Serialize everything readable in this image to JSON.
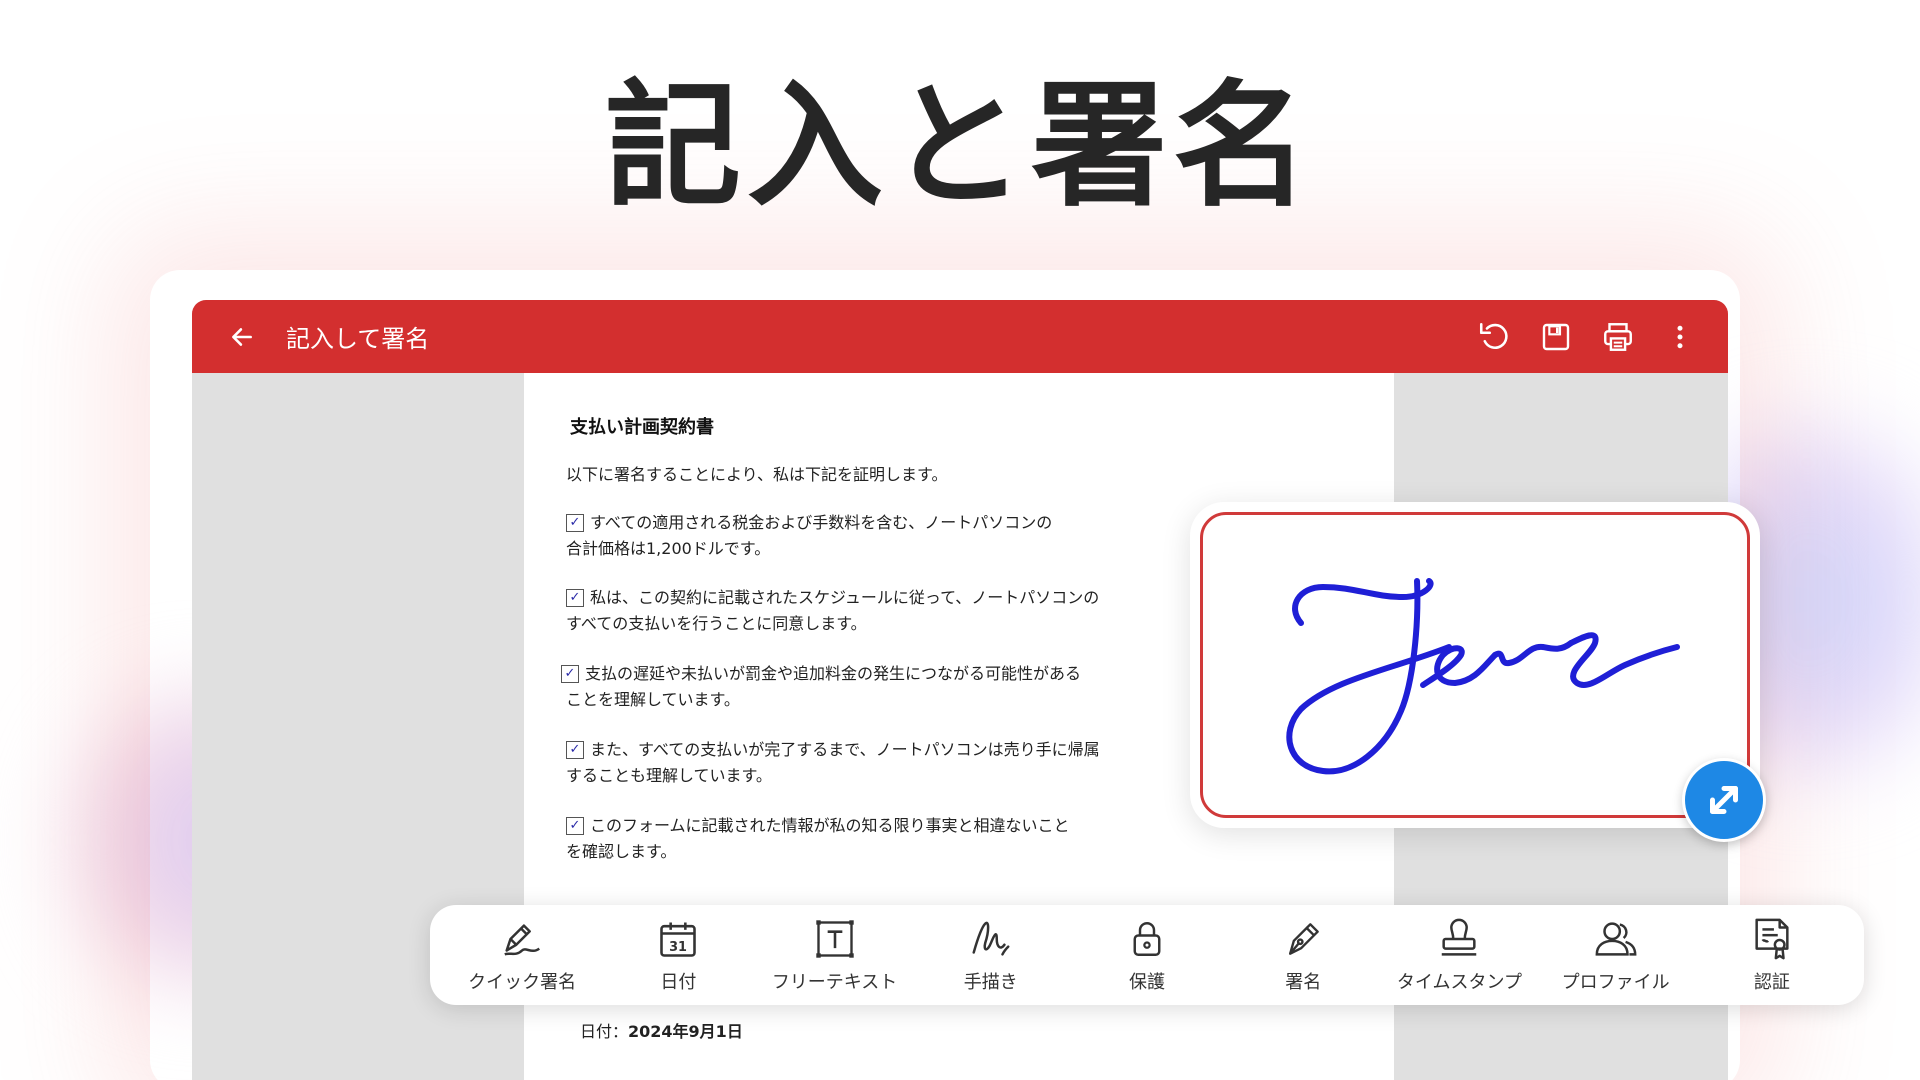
{
  "hero": {
    "title": "記入と署名"
  },
  "app_bar": {
    "title": "記入して署名"
  },
  "document": {
    "title": "支払い計画契約書",
    "intro": "以下に署名することにより、私は下記を証明します。",
    "items": [
      {
        "line1": "すべての適用される税金および手数料を含む、ノートパソコンの",
        "line2": "合計価格は1,200ドルです。"
      },
      {
        "line1": "私は、この契約に記載されたスケジュールに従って、ノートパソコンの",
        "line2": "すべての支払いを行うことに同意します。"
      },
      {
        "line1": "支払の遅延や未払いが罰金や追加料金の発生につながる可能性がある",
        "line2": "ことを理解しています。"
      },
      {
        "line1": "また、すべての支払いが完了するまで、ノートパソコンは売り手に帰属",
        "line2": "することも理解しています。"
      },
      {
        "line1": "このフォームに記載された情報が私の知る限り事実と相違ないこと",
        "line2": "を確認します。"
      }
    ],
    "date_label": "日付：",
    "date_value": "2024年9月1日"
  },
  "toolbar": {
    "tools": [
      {
        "label": "クイック署名",
        "icon": "quick-sign-icon"
      },
      {
        "label": "日付",
        "icon": "calendar-icon"
      },
      {
        "label": "フリーテキスト",
        "icon": "text-box-icon"
      },
      {
        "label": "手描き",
        "icon": "freehand-icon"
      },
      {
        "label": "保護",
        "icon": "lock-icon"
      },
      {
        "label": "署名",
        "icon": "pen-nib-icon"
      },
      {
        "label": "タイムスタンプ",
        "icon": "stamp-icon"
      },
      {
        "label": "プロファイル",
        "icon": "profile-icon"
      },
      {
        "label": "認証",
        "icon": "certificate-icon"
      }
    ]
  },
  "colors": {
    "accent": "#d32f2f",
    "signature_ink": "#1f1fd6",
    "handle": "#1e88e5"
  }
}
